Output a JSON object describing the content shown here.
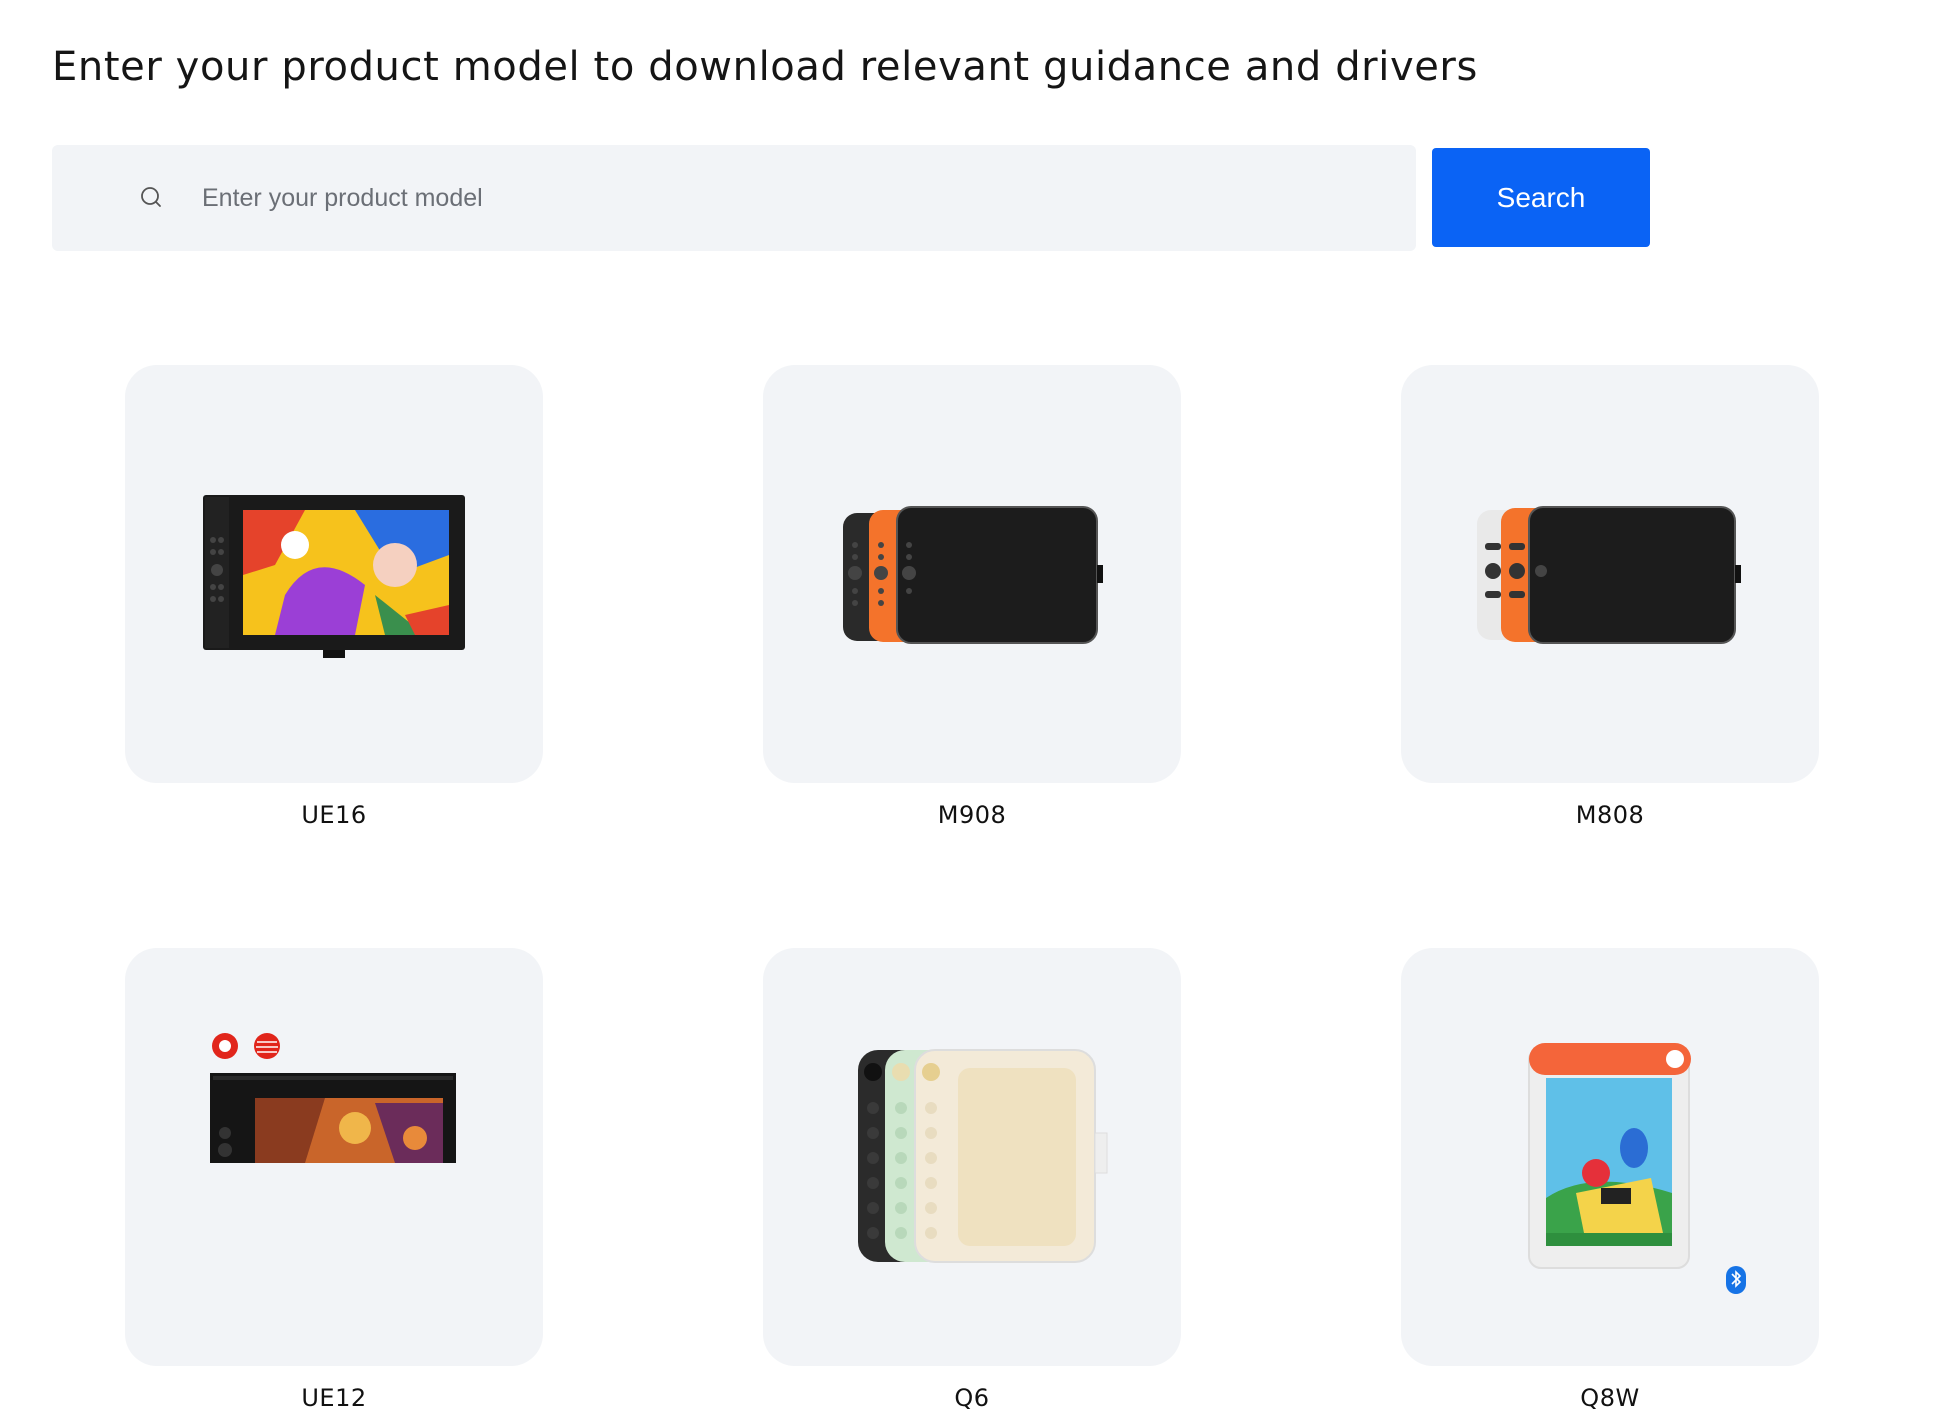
{
  "heading": "Enter your product model to download relevant guidance and drivers",
  "search": {
    "placeholder": "Enter your product model",
    "value": "",
    "button_label": "Search",
    "icon": "search-icon"
  },
  "products": [
    {
      "model": "UE16",
      "image": "pen-display-colorful-art"
    },
    {
      "model": "M908",
      "image": "drawing-tablet-stack-orange"
    },
    {
      "model": "M808",
      "image": "drawing-tablet-stack-white-orange"
    },
    {
      "model": "UE12",
      "image": "pen-display-award-badges"
    },
    {
      "model": "Q6",
      "image": "tablet-stack-pastel"
    },
    {
      "model": "Q8W",
      "image": "tablet-orange-top-bluetooth"
    }
  ],
  "colors": {
    "accent": "#0a63f5",
    "tile_bg": "#f2f4f7",
    "orange": "#f4732b"
  }
}
